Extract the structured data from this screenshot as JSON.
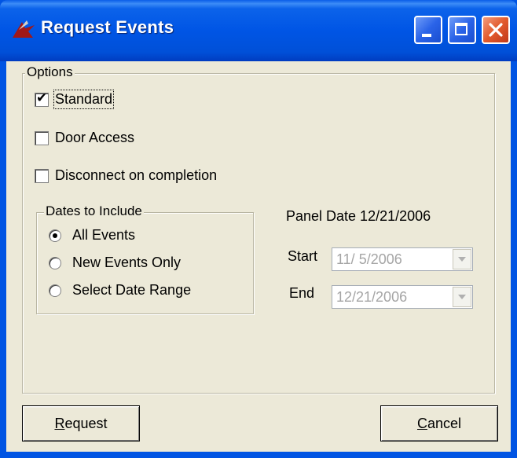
{
  "window": {
    "title": "Request Events",
    "title_bar_color": "#0055e5",
    "icon": "app-logo-icon"
  },
  "options": {
    "legend": "Options",
    "checkboxes": [
      {
        "label": "Standard",
        "checked": true
      },
      {
        "label": "Door Access",
        "checked": false
      },
      {
        "label": "Disconnect on completion",
        "checked": false
      }
    ]
  },
  "dates": {
    "legend": "Dates to Include",
    "radios": [
      {
        "label": "All Events",
        "selected": true
      },
      {
        "label": "New Events Only",
        "selected": false
      },
      {
        "label": "Select Date Range",
        "selected": false
      }
    ]
  },
  "panel": {
    "panel_date_label": "Panel Date 12/21/2006",
    "start_label": "Start",
    "start_value": "11/ 5/2006",
    "end_label": "End",
    "end_value": "12/21/2006"
  },
  "buttons": {
    "request_first": "R",
    "request_rest": "equest",
    "cancel_first": "C",
    "cancel_rest": "ancel"
  }
}
